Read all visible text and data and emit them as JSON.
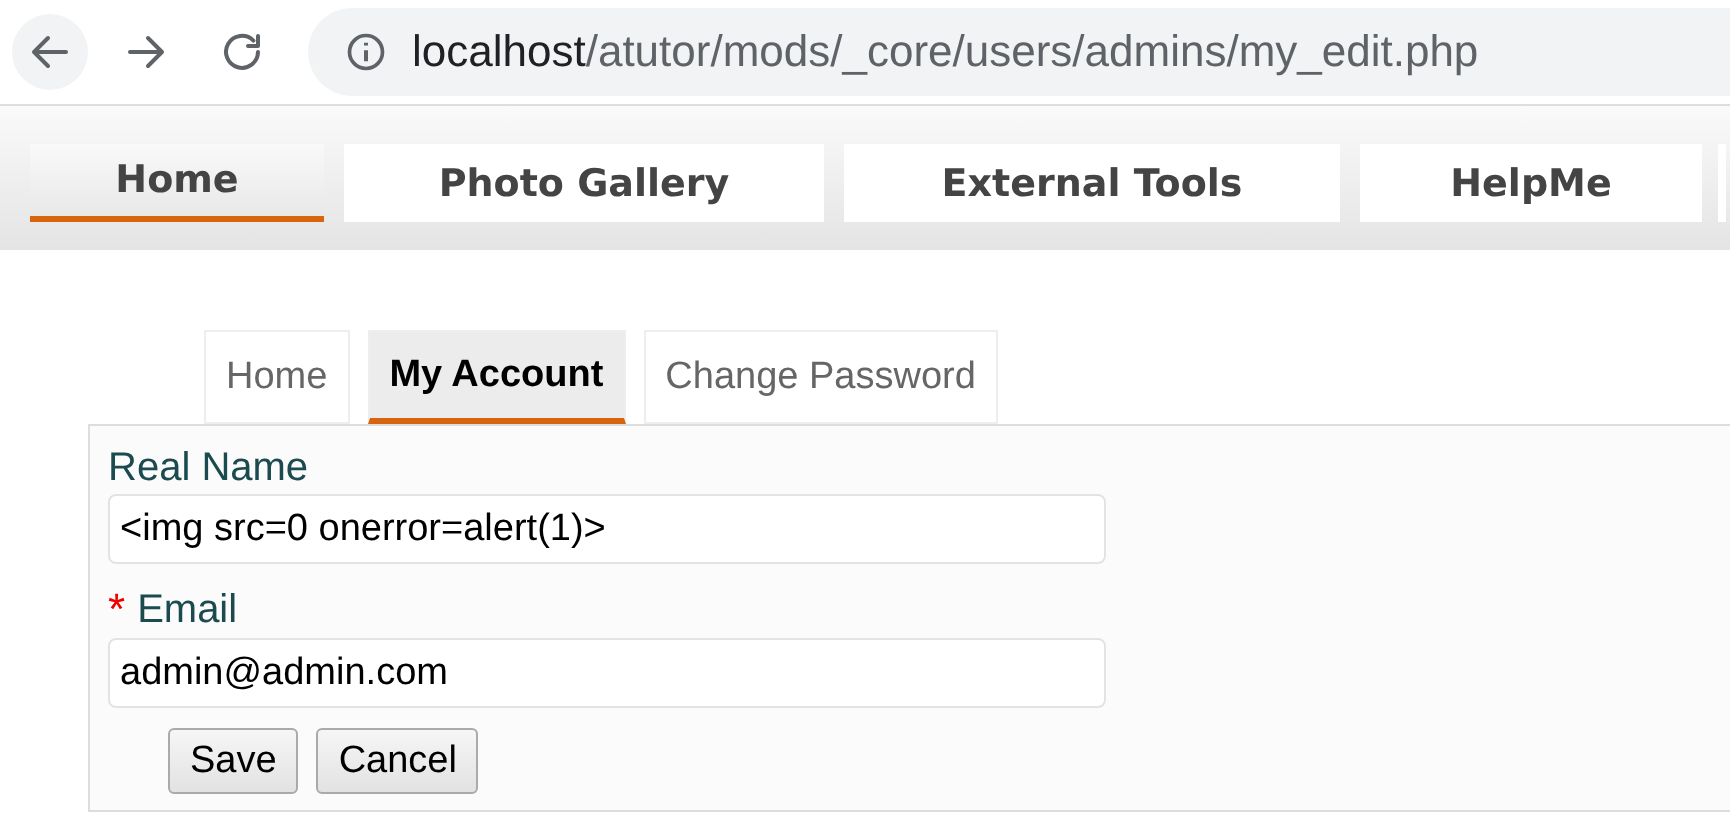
{
  "browser": {
    "address": {
      "host": "localhost",
      "path": "/atutor/mods/_core/users/admins/my_edit.php"
    }
  },
  "nav_tabs": [
    {
      "label": "Home",
      "selected": true
    },
    {
      "label": "Photo Gallery",
      "selected": false
    },
    {
      "label": "External Tools",
      "selected": false
    },
    {
      "label": "HelpMe",
      "selected": false
    }
  ],
  "sub_tabs": [
    {
      "label": "Home",
      "selected": false
    },
    {
      "label": "My Account",
      "selected": true
    },
    {
      "label": "Change Password",
      "selected": false
    }
  ],
  "form": {
    "fields": [
      {
        "label": "Real Name",
        "required": false,
        "value": "<img src=0 onerror=alert(1)>"
      },
      {
        "label": "Email",
        "required": true,
        "required_mark": "*",
        "value": "admin@admin.com"
      }
    ],
    "buttons": [
      "Save",
      "Cancel"
    ]
  }
}
